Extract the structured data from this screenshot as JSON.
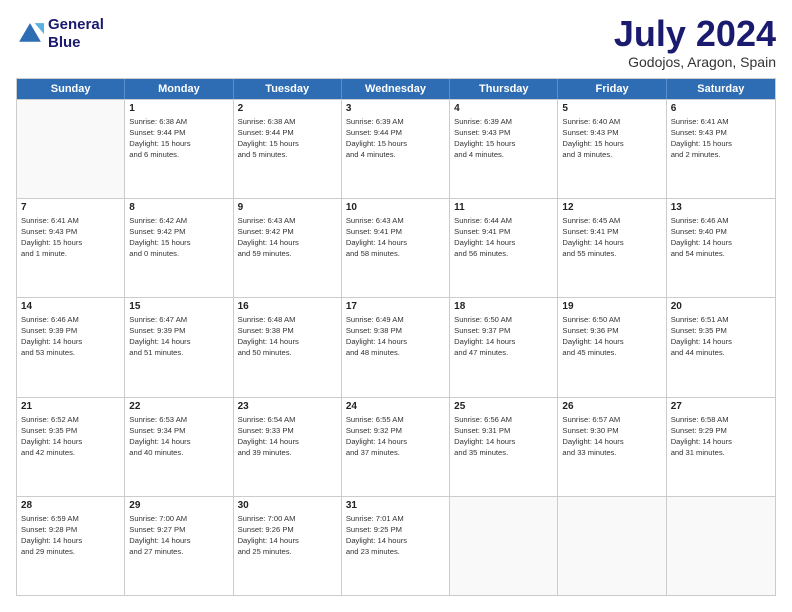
{
  "header": {
    "logo_line1": "General",
    "logo_line2": "Blue",
    "title": "July 2024",
    "subtitle": "Godojos, Aragon, Spain"
  },
  "days_of_week": [
    "Sunday",
    "Monday",
    "Tuesday",
    "Wednesday",
    "Thursday",
    "Friday",
    "Saturday"
  ],
  "weeks": [
    [
      {
        "day": null,
        "info": null
      },
      {
        "day": "1",
        "info": "Sunrise: 6:38 AM\nSunset: 9:44 PM\nDaylight: 15 hours\nand 6 minutes."
      },
      {
        "day": "2",
        "info": "Sunrise: 6:38 AM\nSunset: 9:44 PM\nDaylight: 15 hours\nand 5 minutes."
      },
      {
        "day": "3",
        "info": "Sunrise: 6:39 AM\nSunset: 9:44 PM\nDaylight: 15 hours\nand 4 minutes."
      },
      {
        "day": "4",
        "info": "Sunrise: 6:39 AM\nSunset: 9:43 PM\nDaylight: 15 hours\nand 4 minutes."
      },
      {
        "day": "5",
        "info": "Sunrise: 6:40 AM\nSunset: 9:43 PM\nDaylight: 15 hours\nand 3 minutes."
      },
      {
        "day": "6",
        "info": "Sunrise: 6:41 AM\nSunset: 9:43 PM\nDaylight: 15 hours\nand 2 minutes."
      }
    ],
    [
      {
        "day": "7",
        "info": "Sunrise: 6:41 AM\nSunset: 9:43 PM\nDaylight: 15 hours\nand 1 minute."
      },
      {
        "day": "8",
        "info": "Sunrise: 6:42 AM\nSunset: 9:42 PM\nDaylight: 15 hours\nand 0 minutes."
      },
      {
        "day": "9",
        "info": "Sunrise: 6:43 AM\nSunset: 9:42 PM\nDaylight: 14 hours\nand 59 minutes."
      },
      {
        "day": "10",
        "info": "Sunrise: 6:43 AM\nSunset: 9:41 PM\nDaylight: 14 hours\nand 58 minutes."
      },
      {
        "day": "11",
        "info": "Sunrise: 6:44 AM\nSunset: 9:41 PM\nDaylight: 14 hours\nand 56 minutes."
      },
      {
        "day": "12",
        "info": "Sunrise: 6:45 AM\nSunset: 9:41 PM\nDaylight: 14 hours\nand 55 minutes."
      },
      {
        "day": "13",
        "info": "Sunrise: 6:46 AM\nSunset: 9:40 PM\nDaylight: 14 hours\nand 54 minutes."
      }
    ],
    [
      {
        "day": "14",
        "info": "Sunrise: 6:46 AM\nSunset: 9:39 PM\nDaylight: 14 hours\nand 53 minutes."
      },
      {
        "day": "15",
        "info": "Sunrise: 6:47 AM\nSunset: 9:39 PM\nDaylight: 14 hours\nand 51 minutes."
      },
      {
        "day": "16",
        "info": "Sunrise: 6:48 AM\nSunset: 9:38 PM\nDaylight: 14 hours\nand 50 minutes."
      },
      {
        "day": "17",
        "info": "Sunrise: 6:49 AM\nSunset: 9:38 PM\nDaylight: 14 hours\nand 48 minutes."
      },
      {
        "day": "18",
        "info": "Sunrise: 6:50 AM\nSunset: 9:37 PM\nDaylight: 14 hours\nand 47 minutes."
      },
      {
        "day": "19",
        "info": "Sunrise: 6:50 AM\nSunset: 9:36 PM\nDaylight: 14 hours\nand 45 minutes."
      },
      {
        "day": "20",
        "info": "Sunrise: 6:51 AM\nSunset: 9:35 PM\nDaylight: 14 hours\nand 44 minutes."
      }
    ],
    [
      {
        "day": "21",
        "info": "Sunrise: 6:52 AM\nSunset: 9:35 PM\nDaylight: 14 hours\nand 42 minutes."
      },
      {
        "day": "22",
        "info": "Sunrise: 6:53 AM\nSunset: 9:34 PM\nDaylight: 14 hours\nand 40 minutes."
      },
      {
        "day": "23",
        "info": "Sunrise: 6:54 AM\nSunset: 9:33 PM\nDaylight: 14 hours\nand 39 minutes."
      },
      {
        "day": "24",
        "info": "Sunrise: 6:55 AM\nSunset: 9:32 PM\nDaylight: 14 hours\nand 37 minutes."
      },
      {
        "day": "25",
        "info": "Sunrise: 6:56 AM\nSunset: 9:31 PM\nDaylight: 14 hours\nand 35 minutes."
      },
      {
        "day": "26",
        "info": "Sunrise: 6:57 AM\nSunset: 9:30 PM\nDaylight: 14 hours\nand 33 minutes."
      },
      {
        "day": "27",
        "info": "Sunrise: 6:58 AM\nSunset: 9:29 PM\nDaylight: 14 hours\nand 31 minutes."
      }
    ],
    [
      {
        "day": "28",
        "info": "Sunrise: 6:59 AM\nSunset: 9:28 PM\nDaylight: 14 hours\nand 29 minutes."
      },
      {
        "day": "29",
        "info": "Sunrise: 7:00 AM\nSunset: 9:27 PM\nDaylight: 14 hours\nand 27 minutes."
      },
      {
        "day": "30",
        "info": "Sunrise: 7:00 AM\nSunset: 9:26 PM\nDaylight: 14 hours\nand 25 minutes."
      },
      {
        "day": "31",
        "info": "Sunrise: 7:01 AM\nSunset: 9:25 PM\nDaylight: 14 hours\nand 23 minutes."
      },
      {
        "day": null,
        "info": null
      },
      {
        "day": null,
        "info": null
      },
      {
        "day": null,
        "info": null
      }
    ]
  ]
}
